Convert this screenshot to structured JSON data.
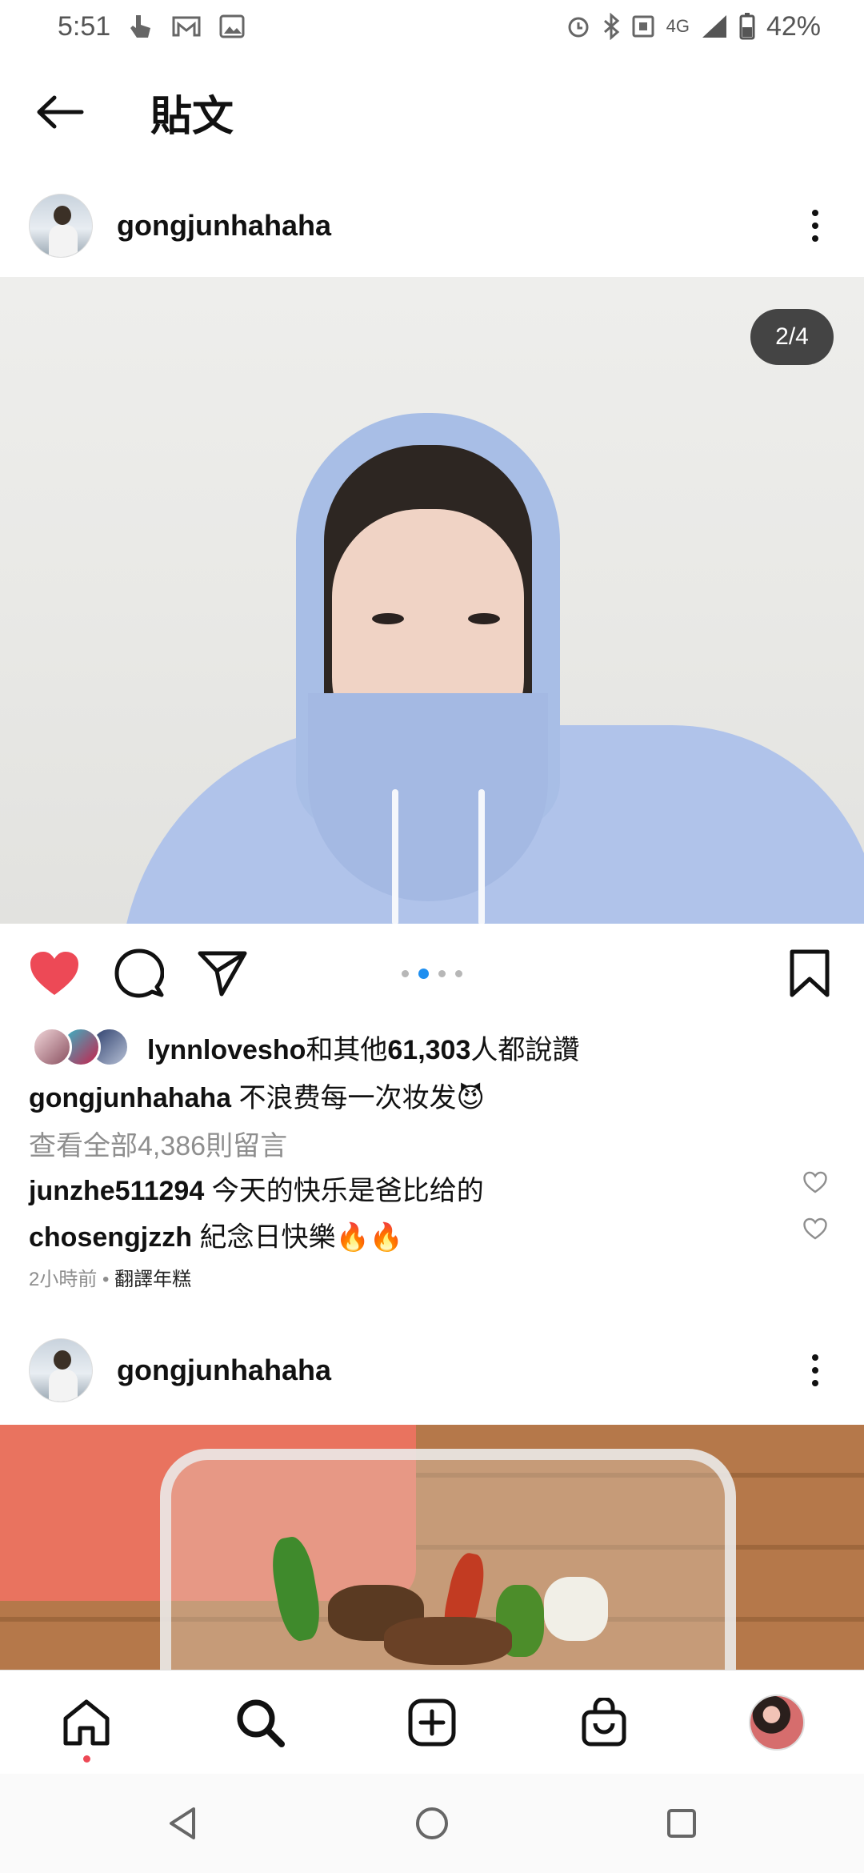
{
  "status_bar": {
    "time": "5:51",
    "battery": "42%",
    "network": "4G"
  },
  "header": {
    "title": "貼文"
  },
  "post": {
    "username": "gongjunhahaha",
    "image_counter": "2/4",
    "carousel": {
      "total": 4,
      "active_index": 1
    },
    "liked": true,
    "likes": {
      "user": "lynnlovesho",
      "middle": "和其他",
      "count": "61,303",
      "suffix": "人都說讚"
    },
    "caption": {
      "user": "gongjunhahaha",
      "text": "不浪费每一次妆发😈"
    },
    "view_comments": "查看全部4,386則留言",
    "comments": [
      {
        "user": "junzhe511294",
        "text": "今天的快乐是爸比给的"
      },
      {
        "user": "chosengjzzh",
        "text": "紀念日快樂🔥🔥"
      }
    ],
    "time_ago": "2小時前",
    "separator": "•",
    "translate": "翻譯年糕"
  },
  "next_post": {
    "username": "gongjunhahaha"
  },
  "colors": {
    "like_red": "#ed4956",
    "carousel_active": "#1f8ff0",
    "accent_dot": "#ed4956"
  },
  "icons": {
    "back": "arrow-left-icon",
    "more": "more-vertical-icon",
    "like": "heart-filled-icon",
    "comment": "comment-icon",
    "share": "paper-plane-icon",
    "save": "bookmark-icon",
    "home": "home-icon",
    "search": "search-icon",
    "create": "plus-square-icon",
    "shop": "shopping-bag-icon"
  }
}
